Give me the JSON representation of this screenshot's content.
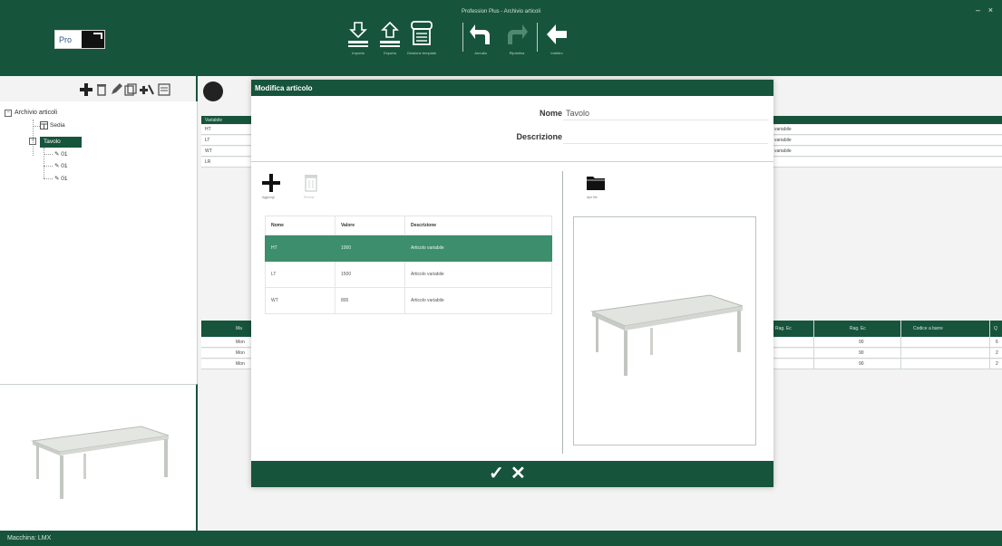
{
  "window": {
    "title": "Profession Plus - Archivio articoli",
    "minimize": "–",
    "close": "×"
  },
  "logo": {
    "text": "Pro"
  },
  "toolbar": {
    "import_label": "Importa",
    "export_label": "Esporta",
    "template_label": "Gestione template",
    "undo_label": "Annulla",
    "redo_label": "Ripristina",
    "back_label": "Indietro"
  },
  "tree": {
    "root": "Archivio articoli",
    "items": [
      "Sedia",
      "Tavolo",
      "01",
      "01",
      "01"
    ]
  },
  "background_table": {
    "header": "Variabile",
    "rows": [
      "HT",
      "LT",
      "WT",
      "LR"
    ],
    "right_values": [
      "variabile",
      "variabile",
      "variabile"
    ],
    "lower_headers": [
      "Ma",
      "Rag. Ec",
      "Rag. Ec",
      "Codice a barre",
      "Q"
    ],
    "lower_rows": [
      {
        "a": "Mon",
        "b": "90",
        "c": "6"
      },
      {
        "a": "Mon",
        "b": "90",
        "c": "2"
      },
      {
        "a": "Mon",
        "b": "90",
        "c": "2"
      }
    ]
  },
  "modal": {
    "title": "Modifica articolo",
    "name_label": "Nome",
    "name_value": "Tavolo",
    "description_label": "Descrizione",
    "description_value": "",
    "add_label": "Aggiungi",
    "delete_label": "Elimina",
    "load_label": "Apri file",
    "grid": {
      "headers": [
        "Nome",
        "Valore",
        "Descrizione"
      ],
      "rows": [
        {
          "name": "HT",
          "value": "1000",
          "description": "Articolo variabile"
        },
        {
          "name": "LT",
          "value": "1500",
          "description": "Articolo variabile"
        },
        {
          "name": "WT",
          "value": "800",
          "description": "Articolo variabile"
        }
      ]
    },
    "confirm": "✓",
    "cancel": "✕"
  },
  "status": {
    "text": "Macchina: LMX"
  },
  "colors": {
    "primary": "#17543c",
    "selected_row": "#3c8e6d"
  }
}
